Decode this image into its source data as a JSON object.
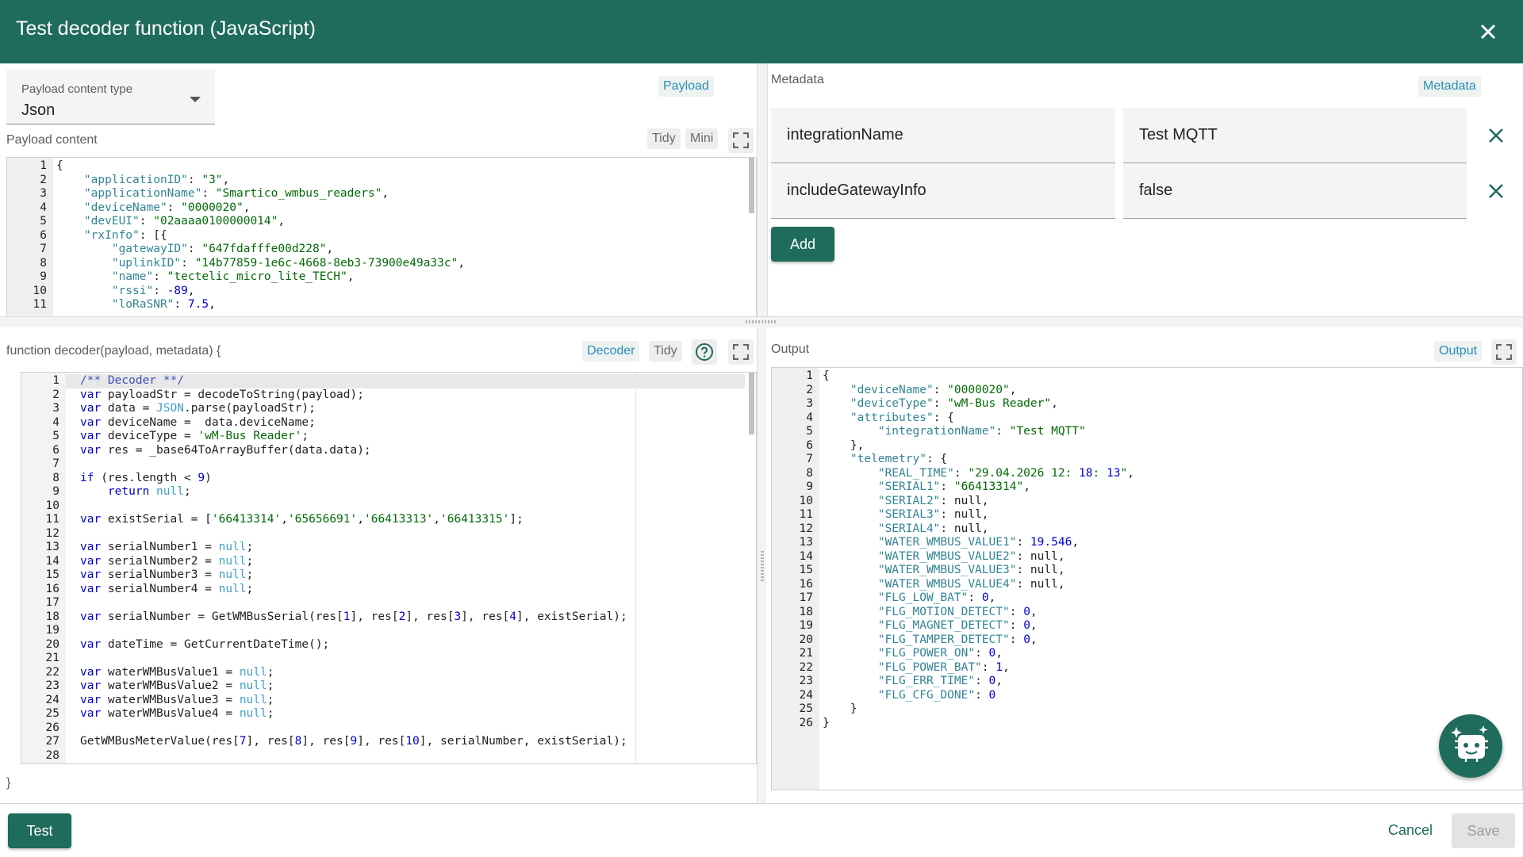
{
  "dialog": {
    "title": "Test decoder function (JavaScript)"
  },
  "payload_panel": {
    "content_type_label": "Payload content type",
    "content_type_value": "Json",
    "chip": "Payload",
    "content_label": "Payload content",
    "tidy_label": "Tidy",
    "mini_label": "Mini",
    "line_numbers": [
      "1",
      "2",
      "3",
      "4",
      "5",
      "6",
      "7",
      "8",
      "9",
      "10",
      "11"
    ],
    "lines": [
      "{",
      "    \"applicationID\": \"3\",",
      "    \"applicationName\": \"Smartico_wmbus_readers\",",
      "    \"deviceName\": \"0000020\",",
      "    \"devEUI\": \"02aaaa0100000014\",",
      "    \"rxInfo\": [{",
      "        \"gatewayID\": \"647fdafffe00d228\",",
      "        \"uplinkID\": \"14b77859-1e6c-4668-8eb3-73900e49a33c\",",
      "        \"name\": \"tectelic_micro_lite_TECH\",",
      "        \"rssi\": -89,",
      "        \"loRaSNR\": 7.5,"
    ]
  },
  "metadata_panel": {
    "label": "Metadata",
    "chip": "Metadata",
    "rows": [
      {
        "key": "integrationName",
        "value": "Test MQTT"
      },
      {
        "key": "includeGatewayInfo",
        "value": "false"
      }
    ],
    "add_label": "Add"
  },
  "decoder_panel": {
    "signature": "function decoder(payload, metadata) {",
    "closing": "}",
    "chip": "Decoder",
    "tidy_label": "Tidy",
    "line_numbers": [
      "1",
      "2",
      "3",
      "4",
      "5",
      "6",
      "7",
      "8",
      "9",
      "10",
      "11",
      "12",
      "13",
      "14",
      "15",
      "16",
      "17",
      "18",
      "19",
      "20",
      "21",
      "22",
      "23",
      "24",
      "25",
      "26",
      "27",
      "28"
    ],
    "lines": [
      "/** Decoder **/",
      "var payloadStr = decodeToString(payload);",
      "var data = JSON.parse(payloadStr);",
      "var deviceName =  data.deviceName;",
      "var deviceType = 'wM-Bus Reader';",
      "var res = _base64ToArrayBuffer(data.data);",
      "",
      "if (res.length < 9)",
      "    return null;",
      "",
      "var existSerial = ['66413314','65656691','66413313','66413315'];",
      "",
      "var serialNumber1 = null;",
      "var serialNumber2 = null;",
      "var serialNumber3 = null;",
      "var serialNumber4 = null;",
      "",
      "var serialNumber = GetWMBusSerial(res[1], res[2], res[3], res[4], existSerial);",
      "",
      "var dateTime = GetCurrentDateTime();",
      "",
      "var waterWMBusValue1 = null;",
      "var waterWMBusValue2 = null;",
      "var waterWMBusValue3 = null;",
      "var waterWMBusValue4 = null;",
      "",
      "GetWMBusMeterValue(res[7], res[8], res[9], res[10], serialNumber, existSerial);",
      ""
    ]
  },
  "output_panel": {
    "label": "Output",
    "chip": "Output",
    "line_numbers": [
      "1",
      "2",
      "3",
      "4",
      "5",
      "6",
      "7",
      "8",
      "9",
      "10",
      "11",
      "12",
      "13",
      "14",
      "15",
      "16",
      "17",
      "18",
      "19",
      "20",
      "21",
      "22",
      "23",
      "24",
      "25",
      "26"
    ],
    "lines": [
      "{",
      "    \"deviceName\": \"0000020\",",
      "    \"deviceType\": \"wM-Bus Reader\",",
      "    \"attributes\": {",
      "        \"integrationName\": \"Test MQTT\"",
      "    },",
      "    \"telemetry\": {",
      "        \"REAL_TIME\": \"29.04.2026 12:18:13\",",
      "        \"SERIAL1\": \"66413314\",",
      "        \"SERIAL2\": null,",
      "        \"SERIAL3\": null,",
      "        \"SERIAL4\": null,",
      "        \"WATER_WMBUS_VALUE1\": 19.546,",
      "        \"WATER_WMBUS_VALUE2\": null,",
      "        \"WATER_WMBUS_VALUE3\": null,",
      "        \"WATER_WMBUS_VALUE4\": null,",
      "        \"FLG_LOW_BAT\": 0,",
      "        \"FLG_MOTION_DETECT\": 0,",
      "        \"FLG_MAGNET_DETECT\": 0,",
      "        \"FLG_TAMPER_DETECT\": 0,",
      "        \"FLG_POWER_ON\": 0,",
      "        \"FLG_POWER_BAT\": 1,",
      "        \"FLG_ERR_TIME\": 0,",
      "        \"FLG_CFG_DONE\": 0",
      "    }",
      "}"
    ]
  },
  "footer": {
    "test_label": "Test",
    "cancel_label": "Cancel",
    "save_label": "Save"
  },
  "colors": {
    "primary": "#1f6b5c",
    "chip_text": "#2a8fb3"
  }
}
